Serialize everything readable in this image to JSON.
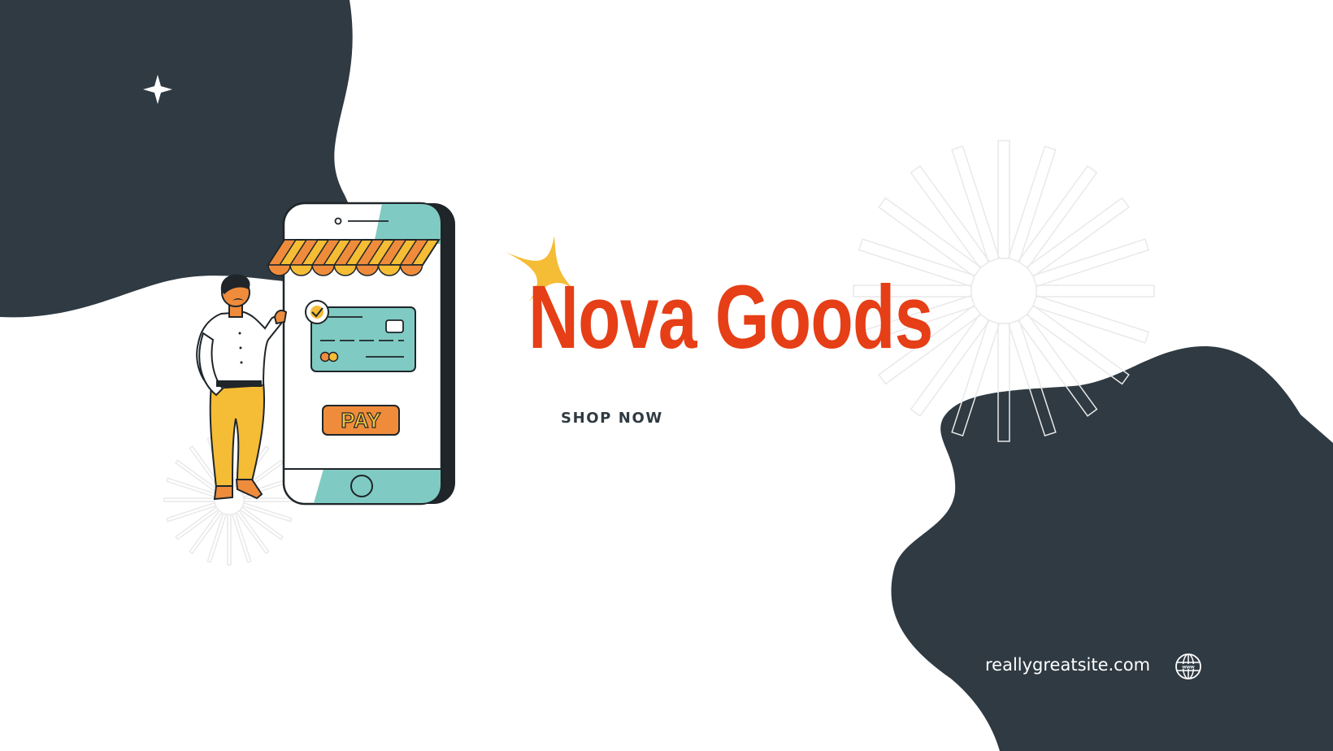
{
  "brand": {
    "name": "Nova Goods"
  },
  "cta": {
    "label": "SHOP NOW"
  },
  "footer": {
    "website": "reallygreatsite.com",
    "icon": "globe-icon"
  },
  "illustration": {
    "pay_label": "PAY",
    "icon": "shopper-with-phone-illustration"
  },
  "colors": {
    "background": "#ffffff",
    "blob": "#2f3a42",
    "brand_red": "#e63e16",
    "accent_yellow": "#f5bc35",
    "accent_orange": "#ef8c3c",
    "teal": "#7fcac3",
    "dark_text": "#2f3a42",
    "burst": "#e9e9e9"
  }
}
